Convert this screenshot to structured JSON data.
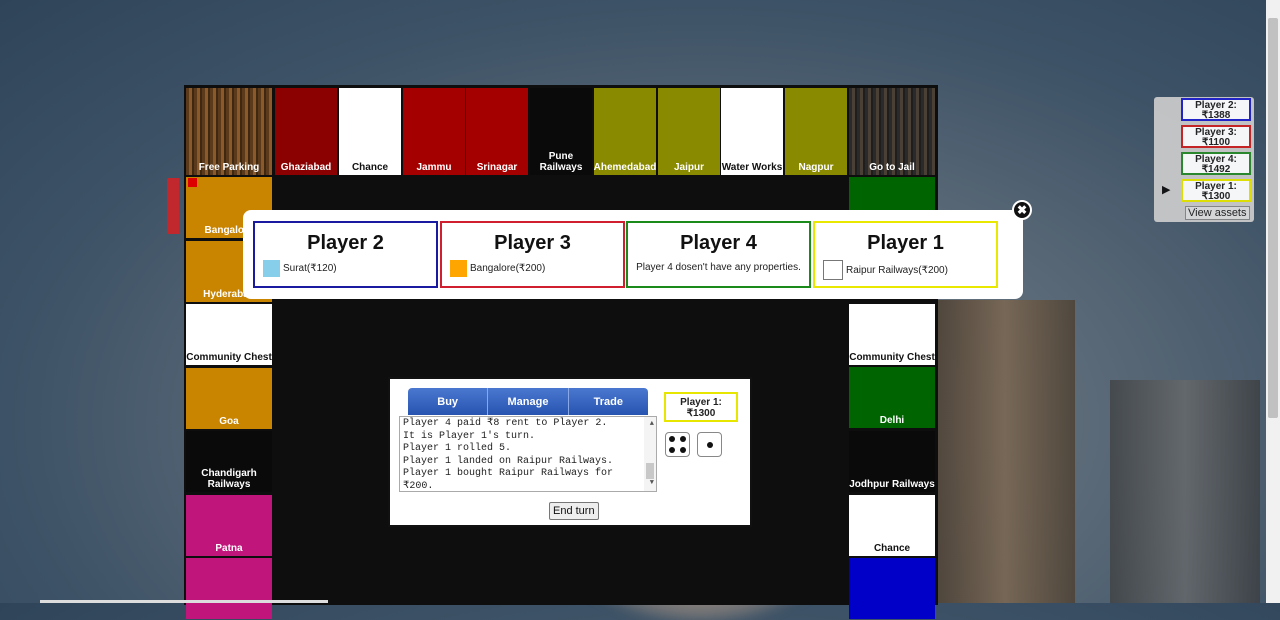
{
  "board": {
    "top_row": [
      {
        "name": "Free Parking",
        "color": "stripes"
      },
      {
        "name": "Ghaziabad",
        "color": "#8b0000"
      },
      {
        "name": "Chance",
        "color": "#ffffff"
      },
      {
        "name": "Jammu",
        "color": "#a50000"
      },
      {
        "name": "Srinagar",
        "color": "#a50000"
      },
      {
        "name": "Pune Railways",
        "color": "#0a0a0a"
      },
      {
        "name": "Ahemedabad",
        "color": "#8a8a00"
      },
      {
        "name": "Jaipur",
        "color": "#8a8a00"
      },
      {
        "name": "Water Works",
        "color": "#ffffff"
      },
      {
        "name": "Nagpur",
        "color": "#8a8a00"
      },
      {
        "name": "Go to Jail",
        "color": "stripes-dark"
      }
    ],
    "left_col": [
      {
        "name": "Bangalore",
        "color": "#c98400"
      },
      {
        "name": "Hyderabad",
        "color": "#c98400"
      },
      {
        "name": "Community Chest",
        "color": "#ffffff"
      },
      {
        "name": "Goa",
        "color": "#c98400"
      },
      {
        "name": "Chandigarh Railways",
        "color": "#0a0a0a"
      },
      {
        "name": "Patna",
        "color": "#c0157a"
      },
      {
        "name": "",
        "color": "#c0157a"
      }
    ],
    "right_col": [
      {
        "name": "",
        "color": "#006400"
      },
      {
        "name": "Community Chest",
        "color": "#ffffff"
      },
      {
        "name": "Delhi",
        "color": "#006400"
      },
      {
        "name": "Jodhpur Railways",
        "color": "#0a0a0a"
      },
      {
        "name": "Chance",
        "color": "#ffffff"
      },
      {
        "name": "",
        "color": "#0000c8"
      }
    ]
  },
  "controls": {
    "tabs": [
      "Buy",
      "Manage",
      "Trade"
    ],
    "log_lines": [
      "Player 4 paid ₹8 rent to Player 2.",
      "It is Player 1's turn.",
      "Player 1 rolled 5.",
      "Player 1 landed on Raipur Railways.",
      "Player 1 bought Raipur Railways for",
      "₹200."
    ],
    "current_player_name": "Player 1:",
    "current_player_money": "₹1300",
    "end_turn": "End turn"
  },
  "players_panel": {
    "players": [
      {
        "name": "Player 2:",
        "money": "₹1388",
        "color": "#2222cc"
      },
      {
        "name": "Player 3:",
        "money": "₹1100",
        "color": "#cc2222"
      },
      {
        "name": "Player 4:",
        "money": "₹1492",
        "color": "#2a8a2a"
      },
      {
        "name": "Player 1:",
        "money": "₹1300",
        "color": "#e6e600"
      }
    ],
    "view_assets": "View assets"
  },
  "assets_modal": {
    "cards": [
      {
        "player": "Player 2",
        "border": "#1a1aa0",
        "property": "Surat(₹120)",
        "swatch": "#87ceeb"
      },
      {
        "player": "Player 3",
        "border": "#d02030",
        "property": "Bangalore(₹200)",
        "swatch": "#ffa500"
      },
      {
        "player": "Player 4",
        "border": "#1a8a1a",
        "note": "Player 4 dosen't have any properties."
      },
      {
        "player": "Player 1",
        "border": "#e8e800",
        "property": "Raipur Railways(₹200)",
        "swatch": "#ffffff"
      }
    ],
    "close_icon": "✖"
  }
}
